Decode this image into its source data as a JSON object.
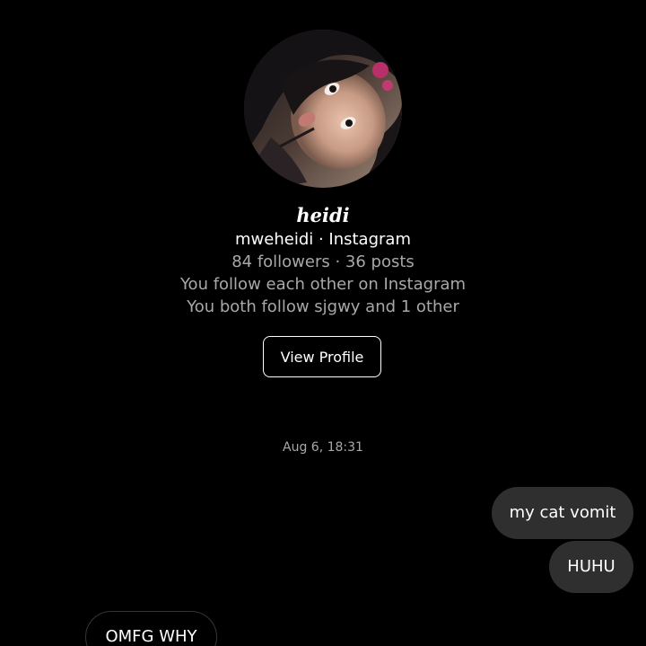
{
  "profile": {
    "display_name": "heidi",
    "handle_line": "mweheidi · Instagram",
    "stats_line": "84 followers · 36 posts",
    "follow_line": "You follow each other on Instagram",
    "mutual_line": "You both follow sjgwy and 1 other",
    "view_profile_label": "View Profile"
  },
  "thread": {
    "timestamp": "Aug 6,  18:31",
    "messages": [
      {
        "direction": "outgoing",
        "text": "my cat vomit"
      },
      {
        "direction": "outgoing",
        "text": "HUHU"
      },
      {
        "direction": "incoming",
        "text": "OMFG WHY"
      }
    ]
  },
  "colors": {
    "background": "#000000",
    "primary_text": "#ffffff",
    "secondary_text": "#a8a8a8",
    "outgoing_bubble": "#2f2f2f",
    "incoming_bubble_border": "#363636"
  }
}
